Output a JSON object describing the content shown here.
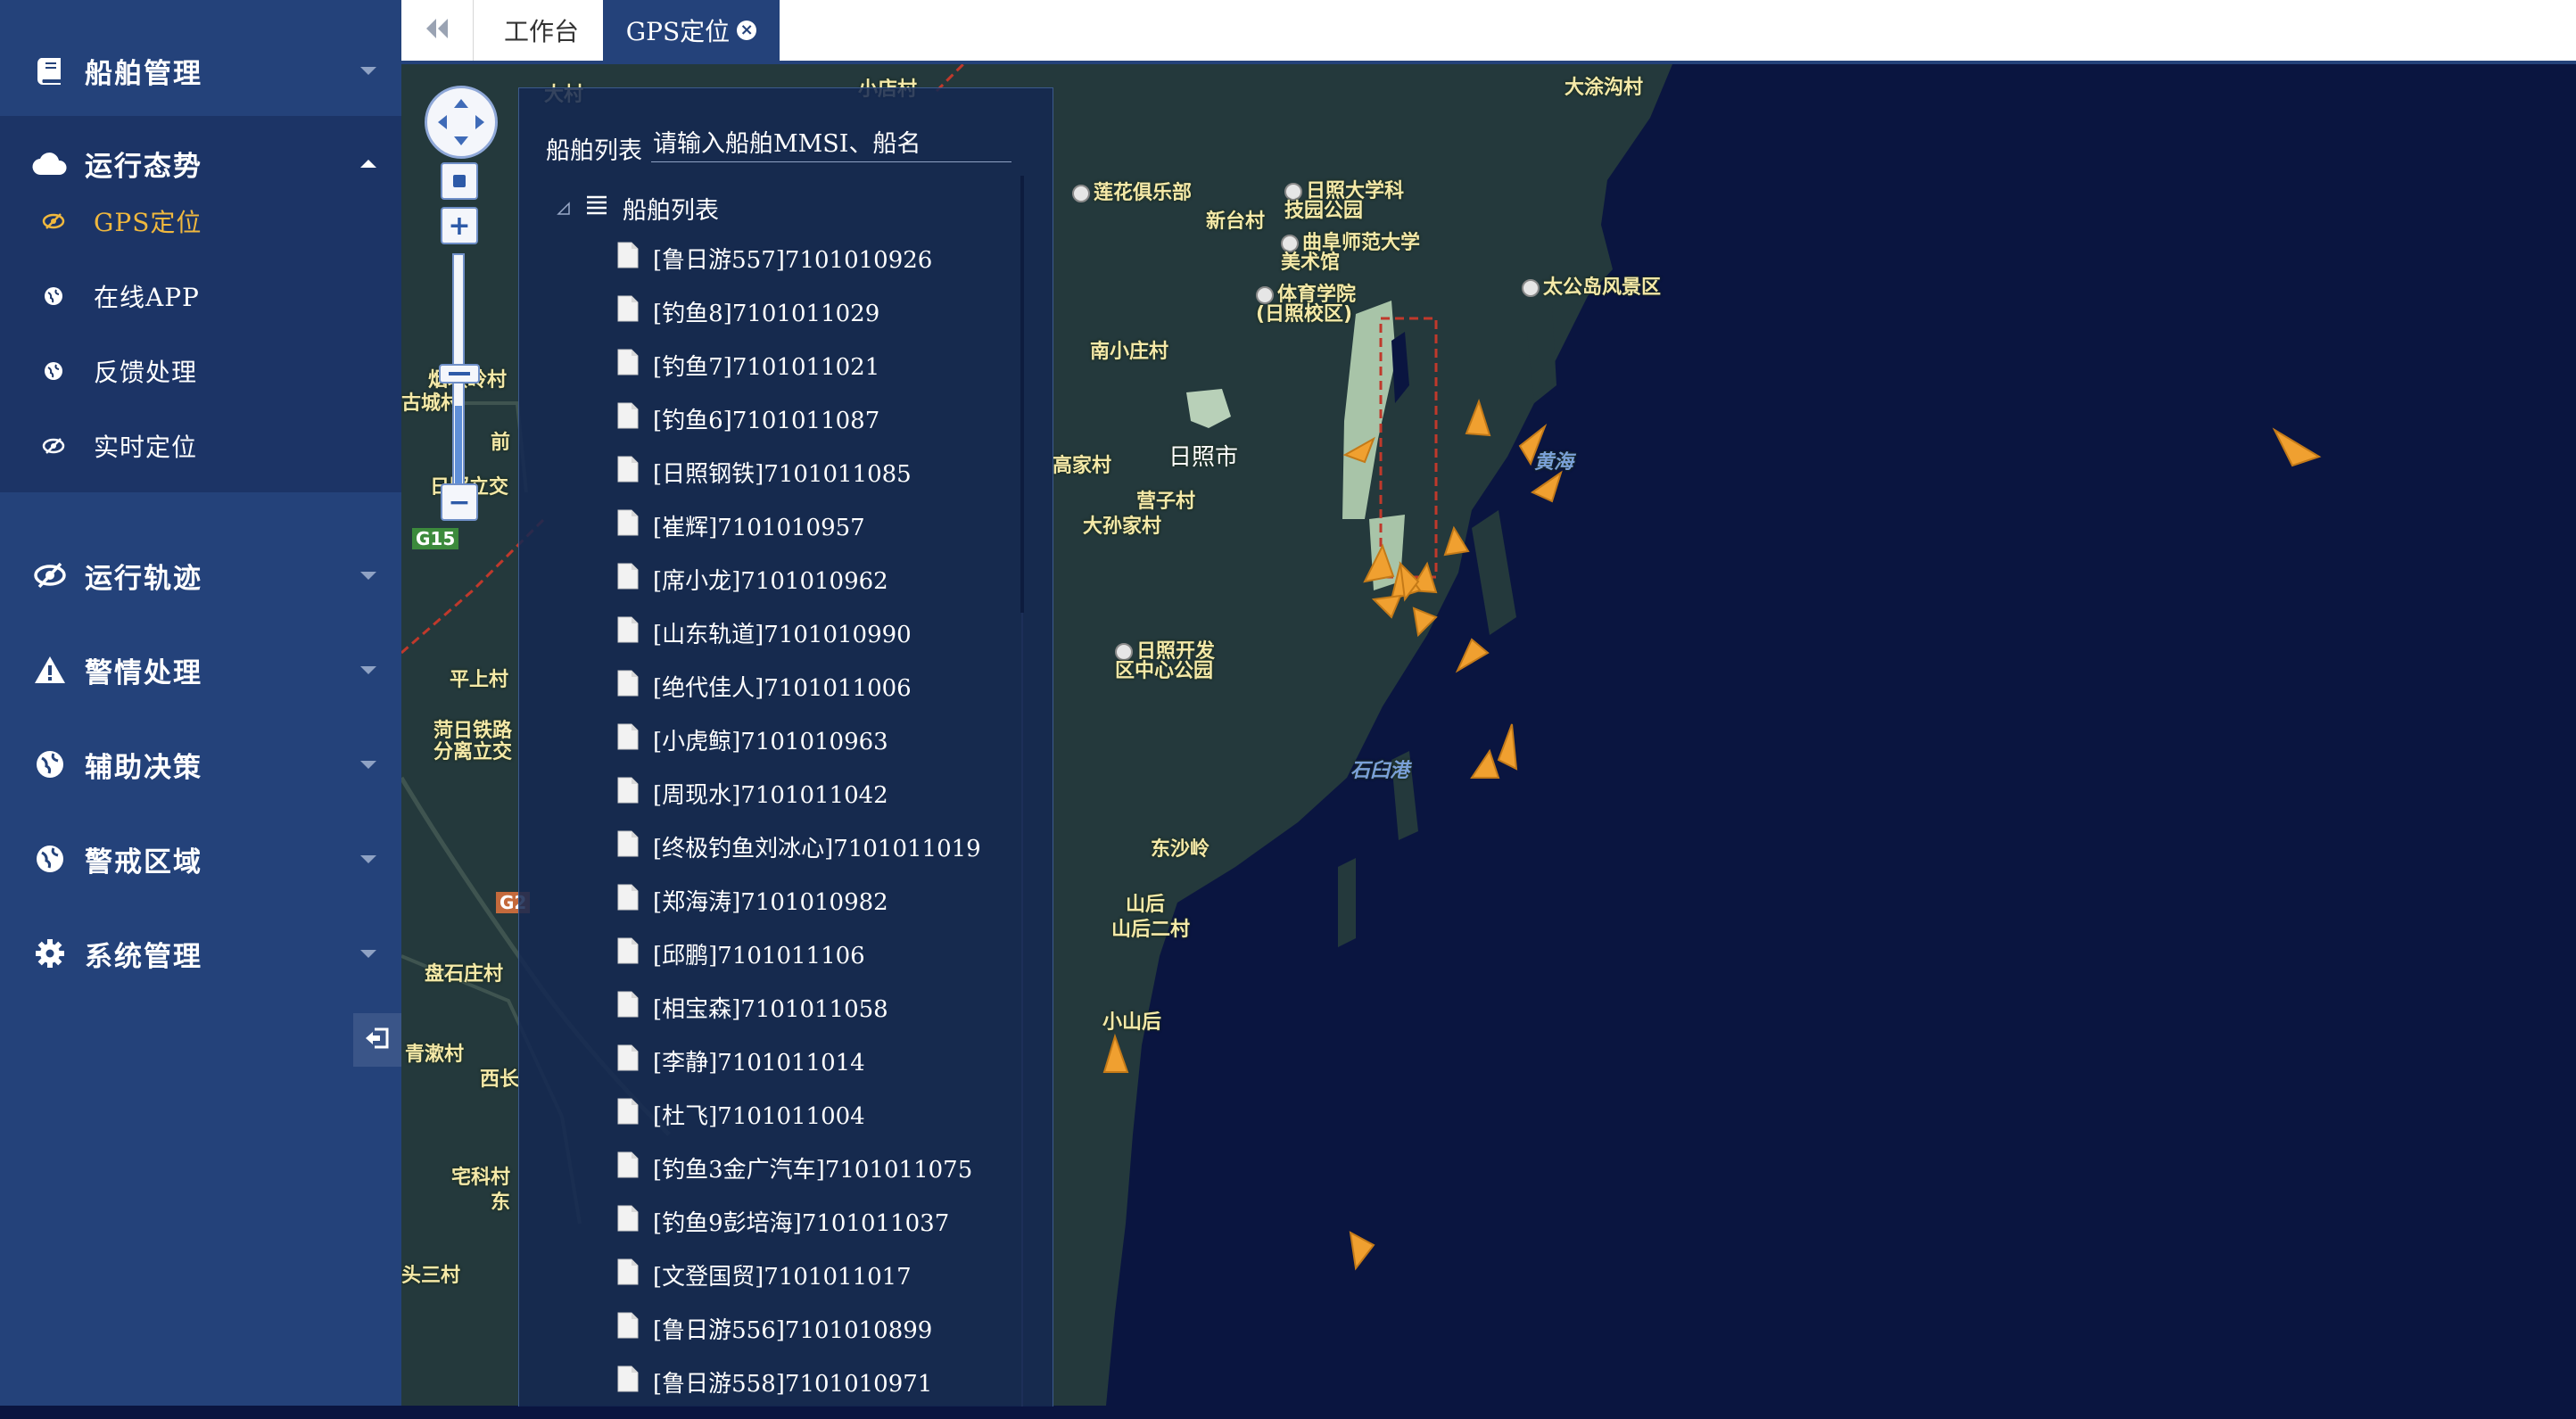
{
  "sidebar": {
    "menus": [
      {
        "id": "ship",
        "label": "船舶管理",
        "icon": "book-icon"
      },
      {
        "id": "status",
        "label": "运行态势",
        "icon": "cloud-icon"
      },
      {
        "id": "track",
        "label": "运行轨迹",
        "icon": "eye-slash-icon"
      },
      {
        "id": "alarm",
        "label": "警情处理",
        "icon": "warning-icon"
      },
      {
        "id": "decision",
        "label": "辅助决策",
        "icon": "globe-icon"
      },
      {
        "id": "zone",
        "label": "警戒区域",
        "icon": "globe-icon"
      },
      {
        "id": "system",
        "label": "系统管理",
        "icon": "gear-icon"
      }
    ],
    "submenu": [
      {
        "label": "GPS定位",
        "icon": "eye-slash-icon",
        "active": true
      },
      {
        "label": "在线APP",
        "icon": "globe-icon"
      },
      {
        "label": "反馈处理",
        "icon": "globe-icon"
      },
      {
        "label": "实时定位",
        "icon": "eye-slash-icon"
      }
    ],
    "accent_color": "#f0b83e",
    "bg_color": "#24427a"
  },
  "tabs": {
    "workbench": "工作台",
    "gps": "GPS定位",
    "active": "gps"
  },
  "panel": {
    "search_label": "船舶列表",
    "search_placeholder": "请输入船舶MMSI、船名",
    "tree_root": "船舶列表",
    "ships": [
      "[鲁日游557]7101010926",
      "[钓鱼8]7101011029",
      "[钓鱼7]7101011021",
      "[钓鱼6]7101011087",
      "[日照钢铁]7101011085",
      "[崔辉]7101010957",
      "[席小龙]7101010962",
      "[山东轨道]7101010990",
      "[绝代佳人]7101011006",
      "[小虎鲸]7101010963",
      "[周现水]7101011042",
      "[终极钓鱼刘冰心]7101011019",
      "[郑海涛]7101010982",
      "[邱鹏]7101011106",
      "[相宝森]7101011058",
      "[李静]7101011014",
      "[杜飞]7101011004",
      "[钓鱼3金广汽车]7101011075",
      "[钓鱼9彭培海]7101011037",
      "[文登国贸]7101011017",
      "[鲁日游556]7101010899",
      "[鲁日游558]7101010971"
    ]
  },
  "map": {
    "labels": {
      "dajiangou": "大涂沟村",
      "lianhua": "莲花俱乐部",
      "xintai": "新台村",
      "rizhao_univ": "日照大学科技园公园",
      "qufu": "曲阜师范大学美术馆",
      "tiyu": "体育学院(日照校区)",
      "dagongdao": "太公岛风景区",
      "nanxiaozhuang": "南小庄村",
      "rizhao_city": "日照市",
      "huanghai": "黄海",
      "gaojia": "高家村",
      "yingzi": "营子村",
      "dasunjia": "大孙家村",
      "kaifaqu": "日照开发区中心公园",
      "shijiugang": "石臼港",
      "dongshaling": "东沙岭",
      "shanhou": "山后",
      "shanhou2": "山后二村",
      "xiaoshanhou": "小山后",
      "rizhao_lijiao": "日照立交",
      "pingshang": "平上村",
      "heri_tielu": "菏日铁路分离立交",
      "panshi": "盘石庄村",
      "qingshan": "青漱村",
      "xichang": "西长",
      "zhaijia": "宅科村",
      "dongxian": "东",
      "yansan": "头三村",
      "dacun": "大村",
      "xiaodianzi": "小店村",
      "yanshao": "烟墩岭村",
      "gucheng": "古城村",
      "qian": "前",
      "road_g15": "G15",
      "road_g2": "G2"
    }
  }
}
